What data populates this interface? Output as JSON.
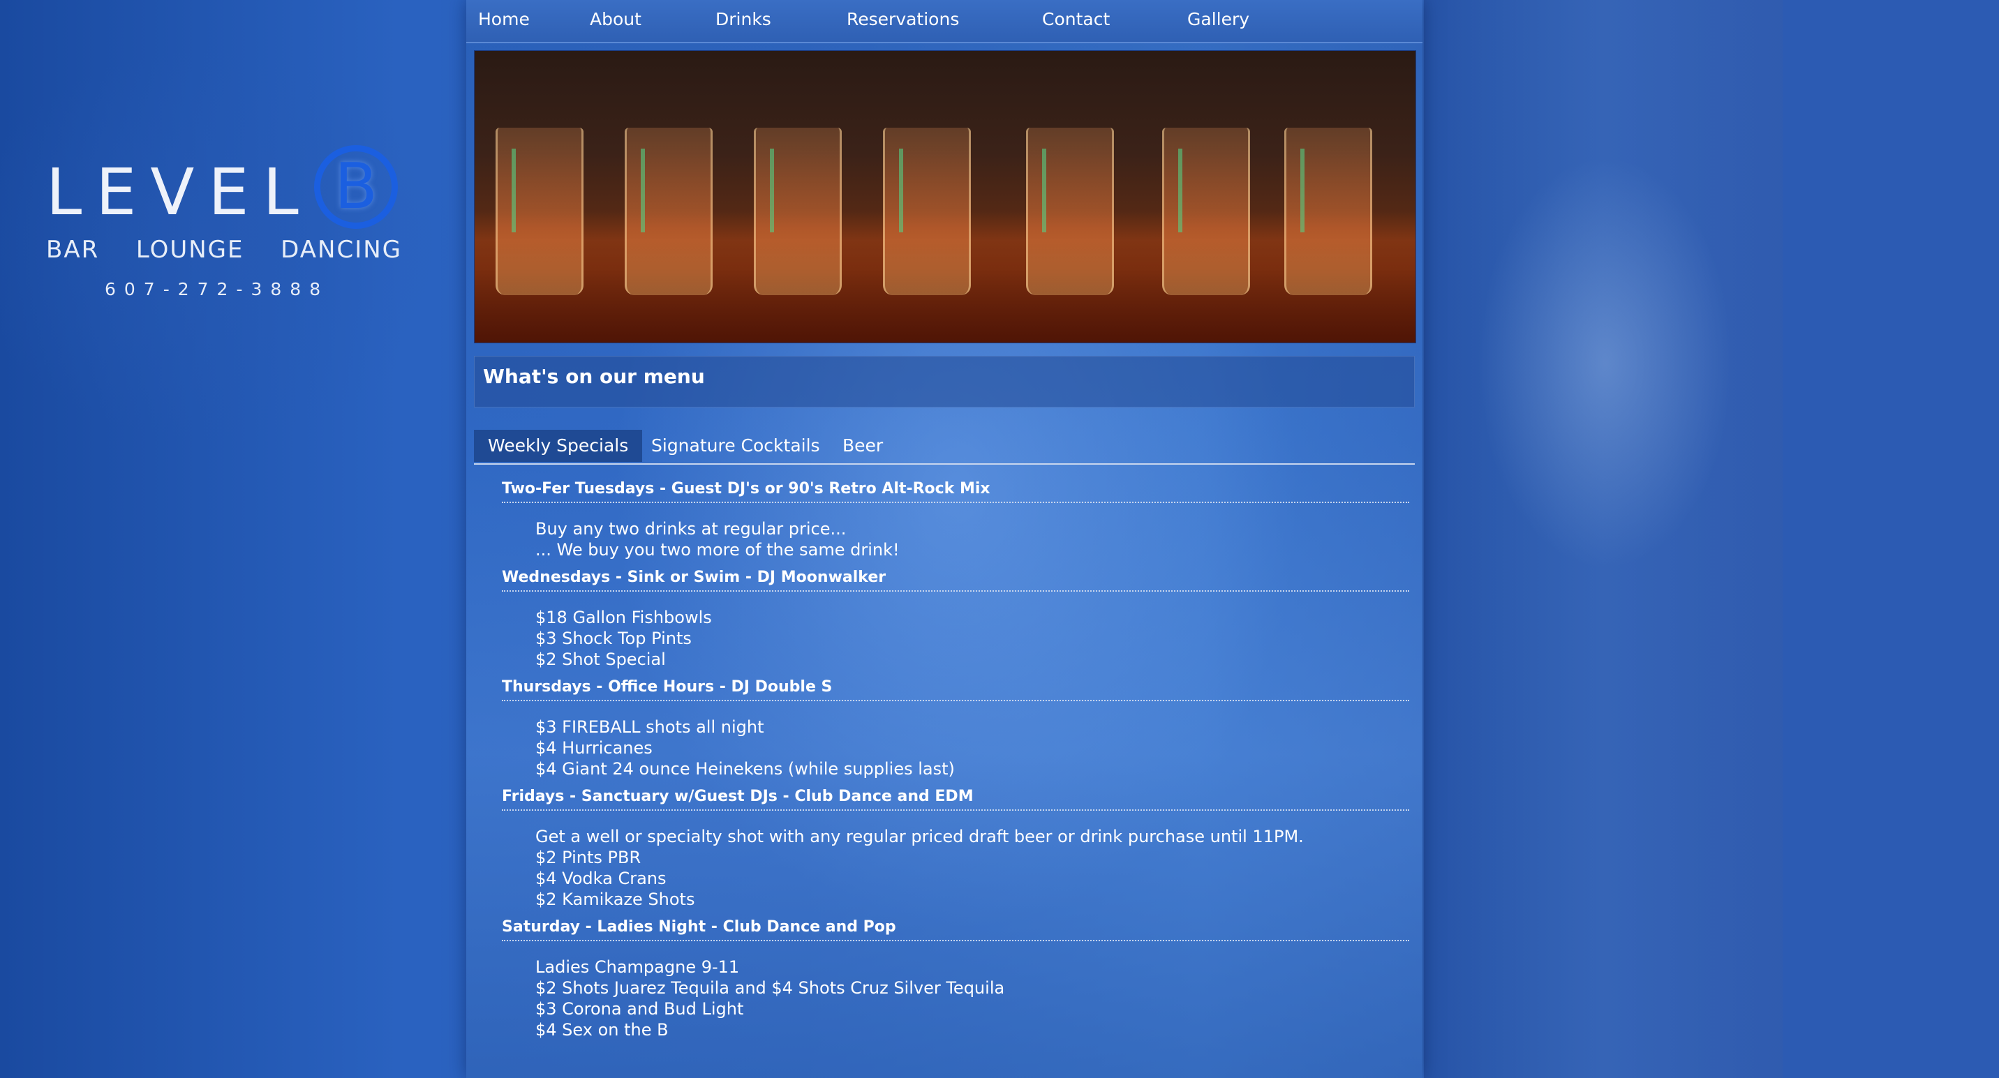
{
  "nav": [
    {
      "label": "Home"
    },
    {
      "label": "About"
    },
    {
      "label": "Drinks"
    },
    {
      "label": "Reservations"
    },
    {
      "label": "Contact"
    },
    {
      "label": "Gallery"
    }
  ],
  "logo": {
    "word": "LEVEL",
    "letter": "B",
    "tags": [
      "BAR",
      "LOUNGE",
      "DANCING"
    ],
    "phone": "607-272-3888"
  },
  "menu": {
    "heading": "What's on our menu",
    "tabs": [
      {
        "label": "Weekly Specials",
        "active": true
      },
      {
        "label": "Signature Cocktails",
        "active": false
      },
      {
        "label": "Beer",
        "active": false
      }
    ]
  },
  "specials": [
    {
      "title": "Two-Fer Tuesdays - Guest DJ's or 90's Retro Alt-Rock Mix",
      "lines": [
        "Buy any two drinks at regular price...",
        "... We buy you two more of the same drink!"
      ]
    },
    {
      "title": "Wednesdays - Sink or Swim - DJ Moonwalker",
      "lines": [
        "$18 Gallon Fishbowls",
        "$3 Shock Top Pints",
        "$2 Shot Special"
      ]
    },
    {
      "title": "Thursdays - Office Hours - DJ Double S",
      "lines": [
        "$3 FIREBALL shots all night",
        "$4 Hurricanes",
        "$4 Giant 24 ounce Heinekens (while supplies last)"
      ]
    },
    {
      "title": "Fridays - Sanctuary w/Guest DJs - Club Dance and EDM",
      "lines": [
        "Get a well or specialty shot with any regular priced draft beer or drink purchase until 11PM.",
        "$2 Pints PBR",
        "$4 Vodka Crans",
        "$2 Kamikaze Shots"
      ]
    },
    {
      "title": "Saturday - Ladies Night - Club Dance and Pop",
      "lines": [
        "Ladies Champagne 9-11",
        "$2 Shots Juarez Tequila and $4 Shots Cruz Silver Tequila",
        "$3 Corona and Bud Light",
        "$4 Sex on the B"
      ]
    }
  ],
  "colors": {
    "background": "#2f66c2",
    "navbar": "#3a6ec4",
    "active_tab": "#1f4a94",
    "logo_accent": "#1b5fe0"
  }
}
